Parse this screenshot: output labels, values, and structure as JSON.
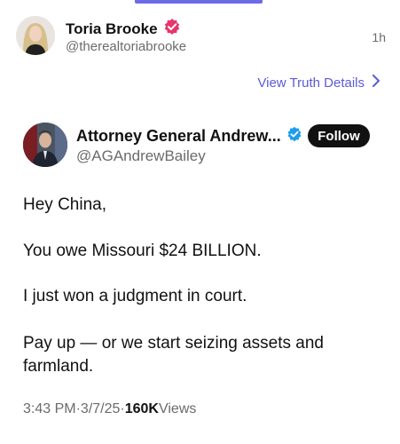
{
  "post": {
    "display_name": "Toria Brooke",
    "handle": "@therealtoriabrooke",
    "time_ago": "1h",
    "details_link": "View Truth Details"
  },
  "embed": {
    "display_name": "Attorney General Andrew...",
    "handle": "@AGAndrewBailey",
    "follow_label": "Follow",
    "body": {
      "line1": "Hey China,",
      "line2": "You owe Missouri $24 BILLION.",
      "line3": "I just won a judgment in court.",
      "line4": "Pay up — or we start seizing assets and farmland."
    },
    "meta": {
      "time": "3:43 PM",
      "sep1": " · ",
      "date": "3/7/25",
      "sep2": " · ",
      "views_count": "160K",
      "views_label": " Views"
    }
  },
  "colors": {
    "accent_purple": "#5b5bd6",
    "verified_pink": "#e8356b",
    "verified_blue": "#1d9bf0",
    "follow_bg": "#111111"
  },
  "icons": {
    "verified_post": "verified-badge-icon",
    "verified_embed": "verified-check-icon",
    "details_chevron": "chevron-right-icon"
  }
}
